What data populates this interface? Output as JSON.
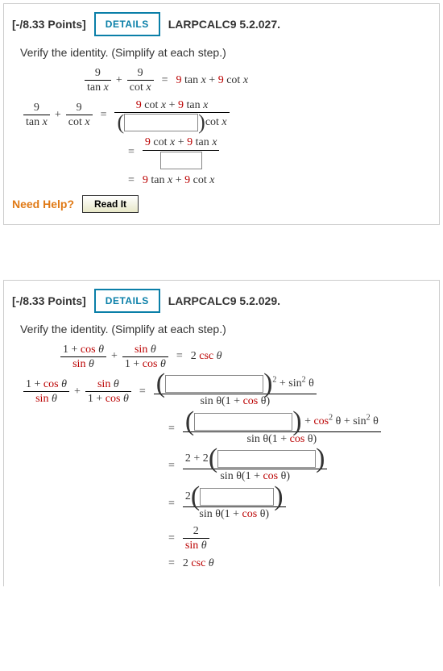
{
  "buttons": {
    "details": "DETAILS",
    "readit": "Read It"
  },
  "needhelp_label": "Need Help?",
  "q1": {
    "points": "[-/8.33 Points]",
    "ref": "LARPCALC9 5.2.027.",
    "instruction": "Verify the identity. (Simplify at each step.)",
    "lhs_a_num": "9",
    "lhs_a_den_fn": "tan",
    "plus": "+",
    "lhs_b_num": "9",
    "lhs_b_den_fn": "cot",
    "var": "x",
    "rhs1": "9 tan x + 9 cot x",
    "s2_num": "9 cot x + 9 tan x",
    "s2_tail_fn": "cot",
    "s3_num": "9 cot x + 9 tan x",
    "s4": "9 tan x + 9 cot x",
    "nine": "9",
    "eq": "="
  },
  "q2": {
    "points": "[-/8.33 Points]",
    "ref": "LARPCALC9 5.2.029.",
    "instruction": "Verify the identity. (Simplify at each step.)",
    "f1_num_a": "1 + ",
    "cos": "cos",
    "sin": "sin",
    "csc": "csc",
    "theta": "θ",
    "plus": "+",
    "rhs1_coef": "2 ",
    "sq": "2",
    "tail1": " + sin",
    "tail2": " θ",
    "tail3": " θ + sin",
    "den_common_a": "sin",
    "den_common_b": " θ(1 + ",
    "den_common_c": " θ)",
    "l3_pre": "2 + 2",
    "l4_pre": "2",
    "l5_num": "2",
    "eq": "="
  }
}
